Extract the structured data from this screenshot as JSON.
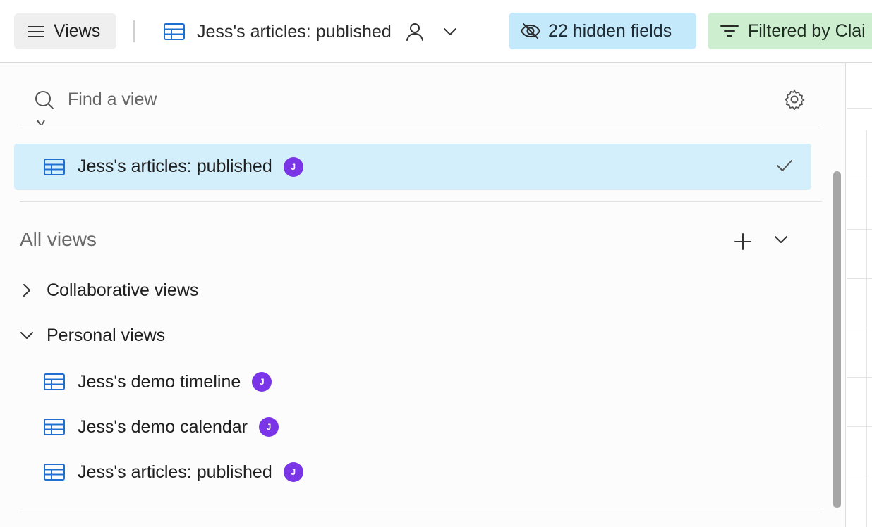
{
  "toolbar": {
    "views_label": "Views",
    "current_view_title": "Jess's articles: published",
    "hidden_fields_label": "22 hidden fields",
    "filter_label": "Filtered by Clai"
  },
  "search": {
    "placeholder": "Find a view"
  },
  "selected_view": {
    "name": "Jess's articles: published",
    "avatar_initial": "J"
  },
  "all_views": {
    "header": "All views",
    "sections": [
      {
        "label": "Collaborative views",
        "expanded": false
      },
      {
        "label": "Personal views",
        "expanded": true
      }
    ],
    "personal_views": [
      {
        "name": "Jess's demo timeline",
        "avatar_initial": "J"
      },
      {
        "name": "Jess's demo calendar",
        "avatar_initial": "J"
      },
      {
        "name": "Jess's articles: published",
        "avatar_initial": "J"
      }
    ]
  },
  "colors": {
    "selected_bg": "#d3effb",
    "hidden_fields_bg": "#c4e9fb",
    "filter_bg": "#cdefcf",
    "avatar": "#7a36e6",
    "grid_icon": "#1f6fd1"
  },
  "icons": [
    "menu-icon",
    "grid-view-icon",
    "person-icon",
    "chevron-down-icon",
    "eye-slash-icon",
    "filter-icon",
    "search-icon",
    "gear-icon",
    "check-icon",
    "plus-icon",
    "chevron-right-icon"
  ]
}
